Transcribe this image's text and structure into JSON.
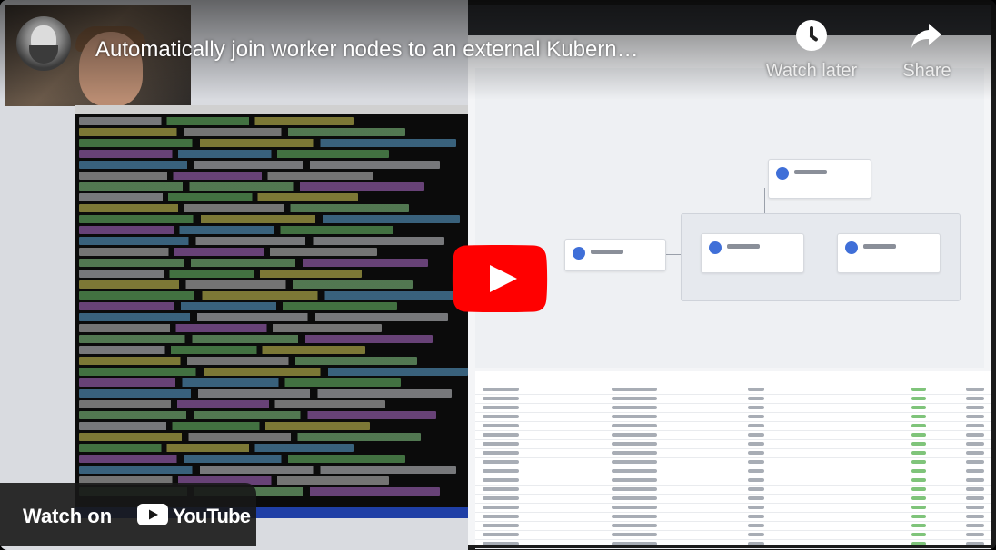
{
  "video": {
    "title": "Automatically join worker nodes to an external Kubern…",
    "channel_avatar_icon": "channel-avatar"
  },
  "actions": {
    "watch_later": {
      "label": "Watch later",
      "icon": "clock-icon"
    },
    "share": {
      "label": "Share",
      "icon": "share-arrow-icon"
    }
  },
  "play_button": {
    "icon": "youtube-play-icon",
    "color": "#ff0000"
  },
  "watch_on": {
    "text": "Watch on",
    "brand": "YouTube",
    "icon": "youtube-logo-icon"
  },
  "colors": {
    "brand_red": "#ff0000",
    "overlay_text": "#ffffff"
  }
}
